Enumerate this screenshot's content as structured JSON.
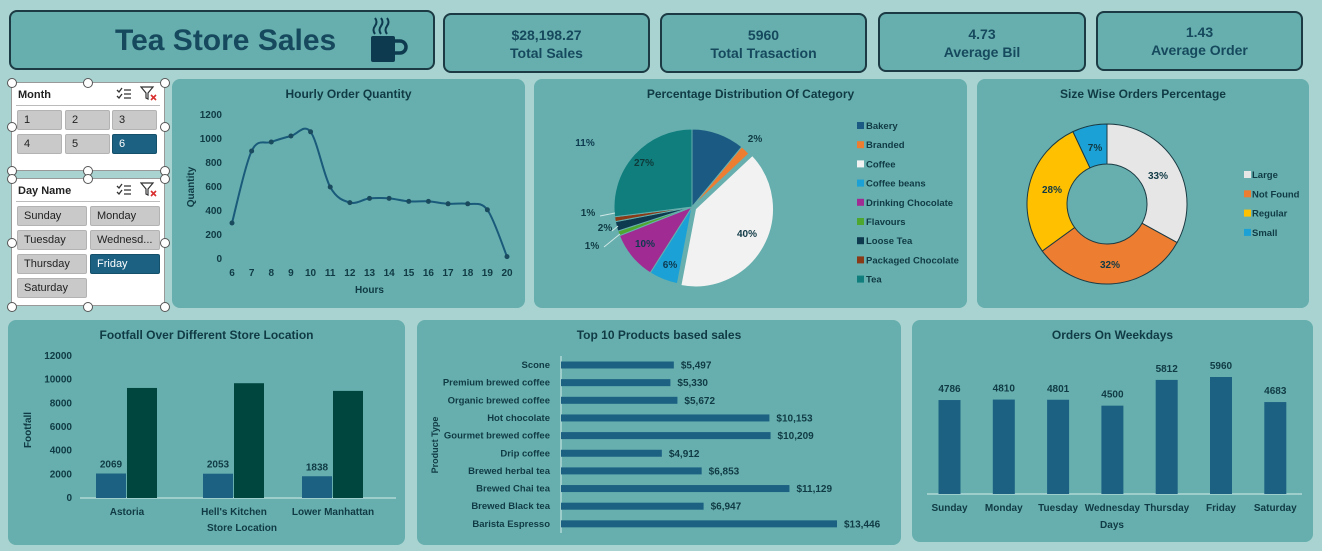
{
  "title": "Tea Store Sales",
  "kpis": [
    {
      "value": "$28,198.27",
      "label": "Total Sales"
    },
    {
      "value": "5960",
      "label": "Total Trasaction"
    },
    {
      "value": "4.73",
      "label": "Average Bil"
    },
    {
      "value": "1.43",
      "label": "Average Order"
    }
  ],
  "slicers": {
    "month": {
      "title": "Month",
      "items": [
        "1",
        "2",
        "3",
        "4",
        "5",
        "6"
      ],
      "selected": "6"
    },
    "day": {
      "title": "Day Name",
      "items": [
        "Sunday",
        "Monday",
        "Tuesday",
        "Wednesd...",
        "Thursday",
        "Friday",
        "Saturday"
      ],
      "selected": "Friday"
    }
  },
  "colors": {
    "bg": "#a9d3d1",
    "panel": "#66afae",
    "dark_blue": "#1c6182",
    "dark_teal": "#01453f",
    "title": "#16495d"
  },
  "chart_data": [
    {
      "type": "line",
      "title": "Hourly Order Quantity",
      "xlabel": "Hours",
      "ylabel": "Quantity",
      "x": [
        6,
        7,
        8,
        9,
        10,
        11,
        12,
        13,
        14,
        15,
        16,
        17,
        18,
        19,
        20
      ],
      "y": [
        300,
        900,
        975,
        1025,
        1060,
        600,
        470,
        505,
        505,
        480,
        480,
        460,
        460,
        410,
        20
      ],
      "yticks": [
        0,
        200,
        400,
        600,
        800,
        1000,
        1200
      ],
      "ylim": [
        0,
        1200
      ]
    },
    {
      "type": "pie",
      "title": "Percentage Distribution Of Category",
      "labels": [
        "Bakery",
        "Branded",
        "Coffee",
        "Coffee beans",
        "Drinking Chocolate",
        "Flavours",
        "Loose Tea",
        "Packaged Chocolate",
        "Tea"
      ],
      "values": [
        11,
        2,
        40,
        6,
        10,
        1,
        2,
        1,
        27
      ],
      "data_labels": [
        "11%",
        "2%",
        "40%",
        "6%",
        "10%",
        "1%",
        "2%",
        "1%",
        "27%"
      ],
      "colors": [
        "#1b5a83",
        "#ed7d31",
        "#f2f2f2",
        "#1ca1d6",
        "#a02b93",
        "#4ea72e",
        "#0e3a4f",
        "#8a3a16",
        "#0f7e7d"
      ],
      "legend": "right"
    },
    {
      "type": "pie",
      "title": "Size Wise Orders Percentage",
      "labels": [
        "Large",
        "Not Found",
        "Regular",
        "Small"
      ],
      "values": [
        33,
        32,
        28,
        7
      ],
      "data_labels": [
        "33%",
        "32%",
        "28%",
        "7%"
      ],
      "colors": [
        "#e6e6e6",
        "#ed7d31",
        "#ffc000",
        "#1ca1d6"
      ],
      "legend": "right"
    },
    {
      "type": "bar",
      "title": "Footfall Over Different Store Location",
      "xlabel": "Store Location",
      "ylabel": "Footfall",
      "categories": [
        "Astoria",
        "Hell's Kitchen",
        "Lower Manhattan"
      ],
      "series": [
        {
          "values": [
            2069,
            2053,
            1838
          ]
        },
        {
          "values": [
            9300,
            9700,
            9050
          ]
        }
      ],
      "data_labels": [
        "2069",
        "2053",
        "1838"
      ],
      "yticks": [
        0,
        2000,
        4000,
        6000,
        8000,
        10000,
        12000
      ],
      "ylim": [
        0,
        12000
      ]
    },
    {
      "type": "bar",
      "title": "Top 10 Products based sales",
      "ylabel": "Product Type",
      "categories": [
        "Scone",
        "Premium brewed coffee",
        "Organic brewed coffee",
        "Hot chocolate",
        "Gourmet brewed coffee",
        "Drip coffee",
        "Brewed herbal tea",
        "Brewed Chai tea",
        "Brewed Black tea",
        "Barista Espresso"
      ],
      "values": [
        5497,
        5330,
        5672,
        10153,
        10209,
        4912,
        6853,
        11129,
        6947,
        13446
      ],
      "data_labels": [
        "$5,497",
        "$5,330",
        "$5,672",
        "$10,153",
        "$10,209",
        "$4,912",
        "$6,853",
        "$11,129",
        "$6,947",
        "$13,446"
      ]
    },
    {
      "type": "bar",
      "title": "Orders On Weekdays",
      "xlabel": "Days",
      "categories": [
        "Sunday",
        "Monday",
        "Tuesday",
        "Wednesday",
        "Thursday",
        "Friday",
        "Saturday"
      ],
      "values": [
        4786,
        4810,
        4801,
        4500,
        5812,
        5960,
        4683
      ],
      "data_labels": [
        "4786",
        "4810",
        "4801",
        "4500",
        "5812",
        "5960",
        "4683"
      ]
    }
  ]
}
